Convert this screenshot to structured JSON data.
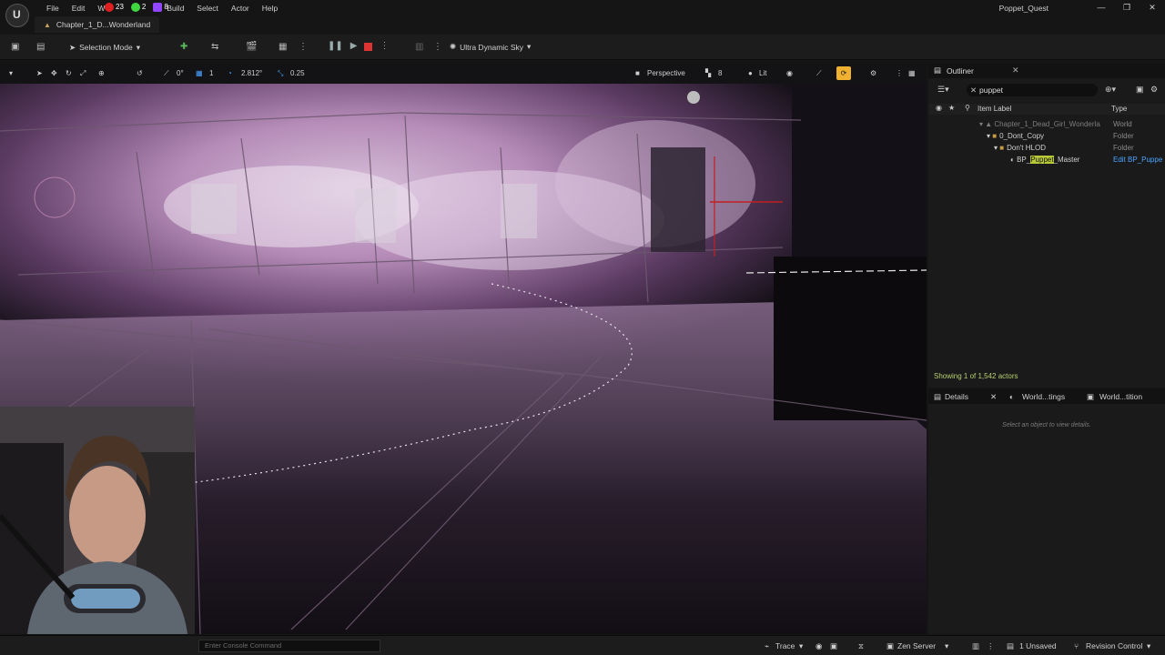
{
  "titlebar": {
    "menu": [
      "File",
      "Edit",
      "W",
      "Build",
      "Select",
      "Actor",
      "Help"
    ],
    "badges": [
      {
        "icon": "youtube-icon",
        "count": "23",
        "color": "#e02020"
      },
      {
        "icon": "kick-icon",
        "count": "2",
        "color": "#3fd63f"
      },
      {
        "icon": "twitch-icon",
        "count": "8",
        "color": "#9146ff"
      }
    ],
    "project_name": "Poppet_Quest",
    "window_controls": [
      "—",
      "❐",
      "✕"
    ]
  },
  "level_tab": {
    "label": "Chapter_1_D...Wonderland"
  },
  "toolbar": {
    "selection_mode": "Selection Mode",
    "play_label": "Play",
    "sky_label": "Ultra Dynamic Sky"
  },
  "viewport_toolbar": {
    "rotation_snap": "0°",
    "grid_snap": "1",
    "scale_value": "2.812°",
    "camera_speed": "0.25",
    "perspective": "Perspective",
    "fov_value": "8",
    "lit": "Lit"
  },
  "outliner": {
    "title": "Outliner",
    "search_value": "puppet",
    "col_label": "Item Label",
    "col_type": "Type",
    "rows": [
      {
        "label": "Chapter_1_Dead_Girl_Wonderla",
        "type": "World",
        "indent": 0,
        "kind": "world"
      },
      {
        "label": "0_Dont_Copy",
        "type": "Folder",
        "indent": 1,
        "kind": "folder"
      },
      {
        "label": "Don't HLOD",
        "type": "Folder",
        "indent": 2,
        "kind": "folder"
      },
      {
        "label_pre": "BP_",
        "label_hl": "Puppet",
        "label_post": "_Master",
        "type": "Edit BP_Puppe",
        "indent": 3,
        "kind": "actor"
      }
    ],
    "showing": "Showing 1 of 1,542 actors"
  },
  "details": {
    "tabs": [
      "Details",
      "World...tings",
      "World...tition"
    ],
    "empty_text": "Select an object to view details."
  },
  "statusbar": {
    "console_placeholder": "Enter Console Command",
    "trace": "Trace",
    "zen_server": "Zen Server",
    "unsaved": "1 Unsaved",
    "revision_control": "Revision Control"
  },
  "colors": {
    "accent_yellow": "#f0b030",
    "search_highlight": "#b8c93a",
    "stop_red": "#d33333"
  }
}
